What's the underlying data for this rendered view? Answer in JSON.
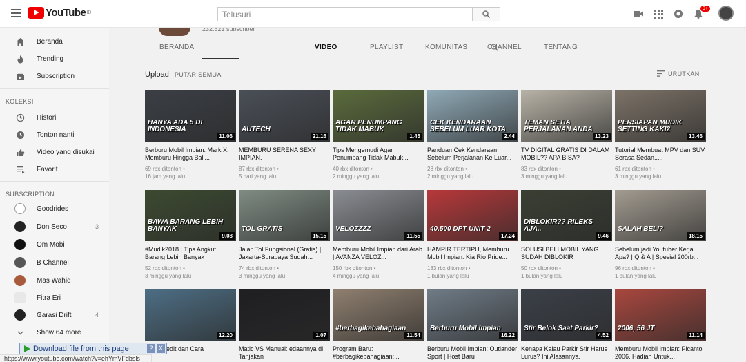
{
  "header": {
    "logo_text": "YouTube",
    "logo_sup": "ID",
    "search_placeholder": "Telusuri",
    "notification_badge": "9+"
  },
  "sidebar": {
    "main": [
      {
        "label": "Beranda",
        "icon": "home-icon"
      },
      {
        "label": "Trending",
        "icon": "flame-icon"
      },
      {
        "label": "Subscription",
        "icon": "subscriptions-icon"
      }
    ],
    "library_heading": "KOLEKSI",
    "library": [
      {
        "label": "Histori",
        "icon": "history-icon"
      },
      {
        "label": "Tonton nanti",
        "icon": "clock-icon"
      },
      {
        "label": "Video yang disukai",
        "icon": "thumbs-up-icon"
      },
      {
        "label": "Favorit",
        "icon": "playlist-icon"
      }
    ],
    "subs_heading": "SUBSCRIPTION",
    "subscriptions": [
      {
        "label": "Goodrides",
        "count": ""
      },
      {
        "label": "Don Seco",
        "count": "3"
      },
      {
        "label": "Om Mobi",
        "count": ""
      },
      {
        "label": "B Channel",
        "count": ""
      },
      {
        "label": "Mas Wahid",
        "count": ""
      },
      {
        "label": "Fitra Eri",
        "count": ""
      },
      {
        "label": "Garasi Drift",
        "count": "4"
      },
      {
        "label": "Show 64 more",
        "count": ""
      }
    ]
  },
  "channel": {
    "subscribers": "232.621 subscriber",
    "tabs": [
      "BERANDA",
      "VIDEO",
      "PLAYLIST",
      "KOMUNITAS",
      "CHANNEL",
      "TENTANG"
    ],
    "active_tab": "VIDEO"
  },
  "section": {
    "title": "Upload",
    "play_all": "PUTAR SEMUA",
    "sort": "URUTKAN"
  },
  "videos": [
    {
      "title": "Berburu Mobil Impian: Mark X. Memburu Hingga Bali...",
      "views": "69 rbx ditonton •",
      "age": "16 jam yang lalu",
      "duration": "11.06",
      "overlay": "HANYA ADA 5 DI INDONESIA",
      "thumb_color": "#3b3f45"
    },
    {
      "title": "MEMBURU SERENA SEXY IMPIAN.",
      "views": "87 rbx ditonton •",
      "age": "5 hari yang lalu",
      "duration": "21.16",
      "overlay": "AUTECH",
      "thumb_color": "#4a4f57"
    },
    {
      "title": "Tips Mengemudi Agar Penumpang Tidak Mabuk...",
      "views": "40 rbx ditonton •",
      "age": "2 minggu yang lalu",
      "duration": "1.45",
      "overlay": "AGAR PENUMPANG TIDAK MABUK",
      "thumb_color": "#5b6b3c"
    },
    {
      "title": "Panduan Cek Kendaraan Sebelum Perjalanan Ke Luar...",
      "views": "28 rbx ditonton •",
      "age": "2 minggu yang lalu",
      "duration": "2.44",
      "overlay": "CEK KENDARAAN SEBELUM LUAR KOTA",
      "thumb_color": "#8fa9b6"
    },
    {
      "title": "TV DIGITAL GRATIS DI DALAM MOBIL?? APA BISA?",
      "views": "83 rbx ditonton •",
      "age": "3 minggu yang lalu",
      "duration": "13.23",
      "overlay": "TEMAN SETIA PERJALANAN ANDA",
      "thumb_color": "#b7b2a6"
    },
    {
      "title": "Tutorial Membuat MPV dan SUV Serasa Sedan.....",
      "views": "61 rbx ditonton •",
      "age": "3 minggu yang lalu",
      "duration": "13.46",
      "overlay": "PERSIAPAN MUDIK SETTING KAKI2",
      "thumb_color": "#7c7267"
    },
    {
      "title": "#Mudik2018 | Tips Angkut Barang Lebih Banyak",
      "views": "52 rbx ditonton •",
      "age": "3 minggu yang lalu",
      "duration": "9.08",
      "overlay": "BAWA BARANG LEBIH BANYAK",
      "thumb_color": "#3c4a30"
    },
    {
      "title": "Jalan Tol Fungsional (Gratis) | Jakarta-Surabaya Sudah...",
      "views": "74 rbx ditonton •",
      "age": "3 minggu yang lalu",
      "duration": "15.15",
      "overlay": "TOL GRATIS",
      "thumb_color": "#7f8c83"
    },
    {
      "title": "Memburu Mobil Impian dari Arab | AVANZA VELOZ...",
      "views": "150 rbx ditonton •",
      "age": "4 minggu yang lalu",
      "duration": "11.55",
      "overlay": "VELOZZZZ",
      "thumb_color": "#8a8d92"
    },
    {
      "title": "HAMPIR TERTIPU, Memburu Mobil Impian: Kia Rio Pride...",
      "views": "183 rbx ditonton •",
      "age": "1 bulan yang lalu",
      "duration": "17.24",
      "overlay": "40.500 DPT UNIT 2",
      "thumb_color": "#b8383a"
    },
    {
      "title": "SOLUSI BELI MOBIL YANG SUDAH DIBLOKIR",
      "views": "50 rbx ditonton •",
      "age": "1 bulan yang lalu",
      "duration": "9.46",
      "overlay": "DIBLOKIR?? RILEKS AJA..",
      "thumb_color": "#3a3f33"
    },
    {
      "title": "Sebelum jadi Youtuber Kerja Apa? | Q & A | Spesial 200rb...",
      "views": "96 rbx ditonton •",
      "age": "1 bulan yang lalu",
      "duration": "18.15",
      "overlay": "SALAH BELI?",
      "thumb_color": "#a29b90"
    },
    {
      "title": "Over Kredit dan Cara",
      "views": "",
      "age": "",
      "duration": "12.20",
      "overlay": "",
      "thumb_color": "#4d6e84"
    },
    {
      "title": "Matic VS Manual: edaannya di Tanjakan",
      "views": "",
      "age": "",
      "duration": "1.07",
      "overlay": "",
      "thumb_color": "#1f1f22"
    },
    {
      "title": "Program Baru: #berbagikebahagiaan:...",
      "views": "",
      "age": "",
      "duration": "11.54",
      "overlay": "#berbagikebahagiaan",
      "thumb_color": "#8f7f6f"
    },
    {
      "title": "Berburu Mobil Impian: Outlander Sport | Host Baru",
      "views": "",
      "age": "",
      "duration": "16.22",
      "overlay": "Berburu Mobil Impian",
      "thumb_color": "#6f7b86"
    },
    {
      "title": "Kenapa Kalau Parkir Stir Harus Lurus? Ini Alasannya.",
      "views": "",
      "age": "",
      "duration": "4.52",
      "overlay": "Stir Belok Saat Parkir?",
      "thumb_color": "#3b4048"
    },
    {
      "title": "Memburu Mobil Impian: Picanto 2006. Hadiah Untuk...",
      "views": "",
      "age": "",
      "duration": "11.14",
      "overlay": "2006, 56 JT",
      "thumb_color": "#a8473e"
    }
  ],
  "download_bar": {
    "label": "Download file from this page",
    "help": "?",
    "close": "X"
  },
  "status_url": "https://www.youtube.com/watch?v=ehYmVFdbsls"
}
